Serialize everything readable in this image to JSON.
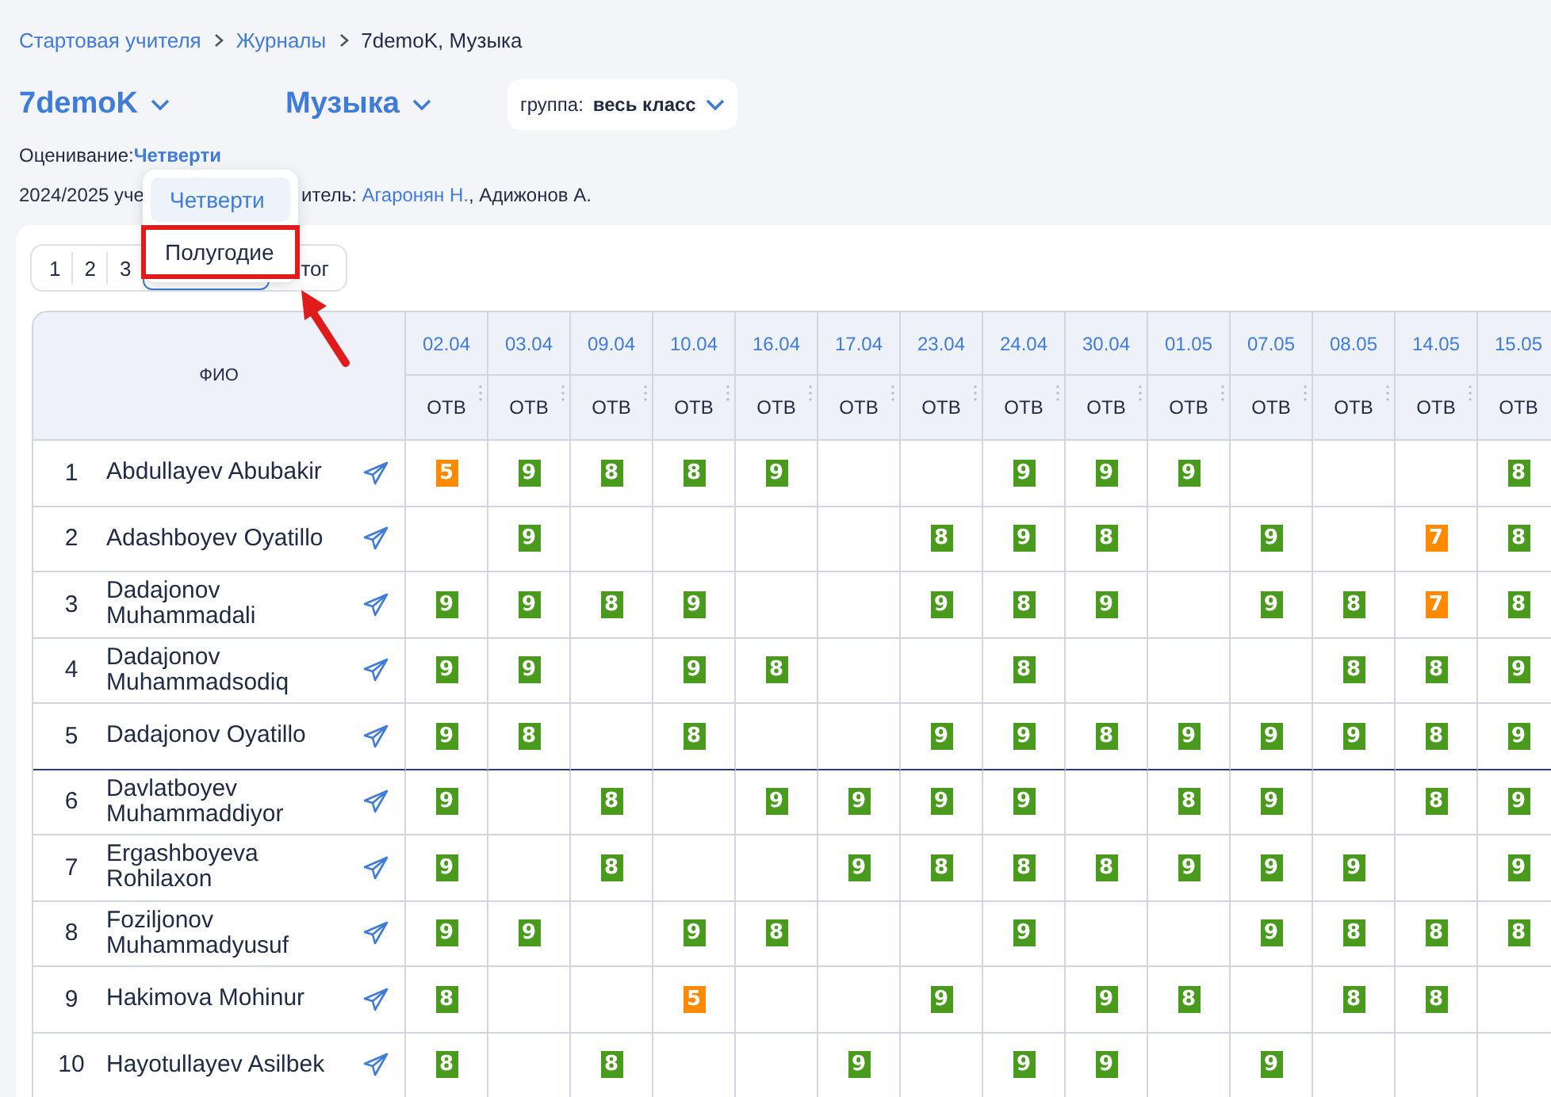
{
  "breadcrumbs": [
    {
      "label": "Стартовая учителя",
      "link": true
    },
    {
      "label": "Журналы",
      "link": true
    },
    {
      "label": "7demoK, Музыка",
      "link": false
    }
  ],
  "class_select": {
    "value": "7demoK"
  },
  "subject_select": {
    "value": "Музыка"
  },
  "group_select": {
    "label": "группа:",
    "value": "весь класс"
  },
  "grading": {
    "label": "Оценивание:",
    "value": "Четверти"
  },
  "info_line": {
    "before": "2024/2025 уче",
    "after": "итель:",
    "teacher_link": "Агаронян Н.",
    "rest": ", Адижонов А."
  },
  "grading_menu": {
    "items": [
      {
        "label": "Четверти",
        "selected": true,
        "highlighted": false
      },
      {
        "label": "Полугодие",
        "selected": false,
        "highlighted": true
      }
    ]
  },
  "period_tabs": [
    {
      "label": "1",
      "selected": false
    },
    {
      "label": "2",
      "selected": false
    },
    {
      "label": "3",
      "selected": false
    },
    {
      "selected": true
    },
    {
      "label": "тог",
      "selected": false
    }
  ],
  "table": {
    "name_header": "ФИО",
    "dates": [
      "02.04",
      "03.04",
      "09.04",
      "10.04",
      "16.04",
      "17.04",
      "23.04",
      "24.04",
      "30.04",
      "01.05",
      "07.05",
      "08.05",
      "14.05",
      "15.05"
    ],
    "types": [
      "ОТВ",
      "ОТВ",
      "ОТВ",
      "ОТВ",
      "ОТВ",
      "ОТВ",
      "ОТВ",
      "ОТВ",
      "ОТВ",
      "ОТВ",
      "ОТВ",
      "ОТВ",
      "ОТВ",
      "ОТВ"
    ],
    "rows": [
      {
        "number": "1",
        "name": "Abdullayev Abubakir",
        "cells": [
          {
            "kind": "grade",
            "mark": "5"
          },
          {
            "kind": "grade",
            "mark": "9"
          },
          {
            "kind": "grade",
            "mark": "8"
          },
          {
            "kind": "grade",
            "mark": "8"
          },
          {
            "kind": "grade",
            "mark": "9"
          },
          {
            "kind": "empty"
          },
          {
            "kind": "empty"
          },
          {
            "kind": "grade",
            "mark": "9"
          },
          {
            "kind": "grade",
            "mark": "9"
          },
          {
            "kind": "grade",
            "mark": "9"
          },
          {
            "kind": "empty"
          },
          {
            "kind": "empty"
          },
          {
            "kind": "empty"
          },
          {
            "kind": "grade",
            "mark": "8"
          }
        ]
      },
      {
        "number": "2",
        "name": "Adashboyev Oyatillo",
        "cells": [
          {
            "kind": "empty"
          },
          {
            "kind": "grade",
            "mark": "9"
          },
          {
            "kind": "empty"
          },
          {
            "kind": "empty"
          },
          {
            "kind": "empty"
          },
          {
            "kind": "empty"
          },
          {
            "kind": "grade",
            "mark": "8"
          },
          {
            "kind": "grade",
            "mark": "9"
          },
          {
            "kind": "grade",
            "mark": "8"
          },
          {
            "kind": "empty"
          },
          {
            "kind": "grade",
            "mark": "9"
          },
          {
            "kind": "empty"
          },
          {
            "kind": "grade",
            "mark": "7"
          },
          {
            "kind": "grade",
            "mark": "8"
          }
        ]
      },
      {
        "number": "3",
        "name": "Dadajonov Muhammadali",
        "cells": [
          {
            "kind": "grade",
            "mark": "9"
          },
          {
            "kind": "grade",
            "mark": "9"
          },
          {
            "kind": "grade",
            "mark": "8"
          },
          {
            "kind": "grade",
            "mark": "9"
          },
          {
            "kind": "empty"
          },
          {
            "kind": "empty"
          },
          {
            "kind": "grade",
            "mark": "9"
          },
          {
            "kind": "grade",
            "mark": "8"
          },
          {
            "kind": "grade",
            "mark": "9"
          },
          {
            "kind": "empty"
          },
          {
            "kind": "grade",
            "mark": "9"
          },
          {
            "kind": "grade",
            "mark": "8"
          },
          {
            "kind": "grade",
            "mark": "7"
          },
          {
            "kind": "grade",
            "mark": "8"
          }
        ]
      },
      {
        "number": "4",
        "name": "Dadajonov Muhammadsodiq",
        "cells": [
          {
            "kind": "grade",
            "mark": "9"
          },
          {
            "kind": "grade",
            "mark": "9"
          },
          {
            "kind": "empty"
          },
          {
            "kind": "grade",
            "mark": "9"
          },
          {
            "kind": "grade",
            "mark": "8"
          },
          {
            "kind": "empty"
          },
          {
            "kind": "empty"
          },
          {
            "kind": "grade",
            "mark": "8"
          },
          {
            "kind": "empty"
          },
          {
            "kind": "empty"
          },
          {
            "kind": "empty"
          },
          {
            "kind": "grade",
            "mark": "8"
          },
          {
            "kind": "grade",
            "mark": "8"
          },
          {
            "kind": "grade",
            "mark": "9"
          }
        ]
      },
      {
        "number": "5",
        "name": "Dadajonov Oyatillo",
        "cells": [
          {
            "kind": "grade",
            "mark": "9"
          },
          {
            "kind": "grade",
            "mark": "8"
          },
          {
            "kind": "empty"
          },
          {
            "kind": "grade",
            "mark": "8"
          },
          {
            "kind": "empty"
          },
          {
            "kind": "empty"
          },
          {
            "kind": "grade",
            "mark": "9"
          },
          {
            "kind": "grade",
            "mark": "9"
          },
          {
            "kind": "grade",
            "mark": "8"
          },
          {
            "kind": "grade",
            "mark": "9"
          },
          {
            "kind": "grade",
            "mark": "9"
          },
          {
            "kind": "grade",
            "mark": "9"
          },
          {
            "kind": "grade",
            "mark": "8"
          },
          {
            "kind": "grade",
            "mark": "9"
          }
        ]
      },
      {
        "number": "6",
        "name": "Davlatboyev Muhammaddiyor",
        "cells": [
          {
            "kind": "grade",
            "mark": "9"
          },
          {
            "kind": "empty"
          },
          {
            "kind": "grade",
            "mark": "8"
          },
          {
            "kind": "empty"
          },
          {
            "kind": "grade",
            "mark": "9"
          },
          {
            "kind": "grade",
            "mark": "9"
          },
          {
            "kind": "grade",
            "mark": "9"
          },
          {
            "kind": "grade",
            "mark": "9"
          },
          {
            "kind": "empty"
          },
          {
            "kind": "grade",
            "mark": "8"
          },
          {
            "kind": "grade",
            "mark": "9"
          },
          {
            "kind": "empty"
          },
          {
            "kind": "grade",
            "mark": "8"
          },
          {
            "kind": "grade",
            "mark": "9"
          }
        ]
      },
      {
        "number": "7",
        "name": "Ergashboyeva Rohilaxon",
        "cells": [
          {
            "kind": "grade",
            "mark": "9"
          },
          {
            "kind": "empty"
          },
          {
            "kind": "grade",
            "mark": "8"
          },
          {
            "kind": "empty"
          },
          {
            "kind": "empty"
          },
          {
            "kind": "grade",
            "mark": "9"
          },
          {
            "kind": "grade",
            "mark": "8"
          },
          {
            "kind": "grade",
            "mark": "8"
          },
          {
            "kind": "grade",
            "mark": "8"
          },
          {
            "kind": "grade",
            "mark": "9"
          },
          {
            "kind": "grade",
            "mark": "9"
          },
          {
            "kind": "grade",
            "mark": "9"
          },
          {
            "kind": "empty"
          },
          {
            "kind": "grade",
            "mark": "9"
          }
        ]
      },
      {
        "number": "8",
        "name": "Foziljonov Muhammadyusuf",
        "cells": [
          {
            "kind": "grade",
            "mark": "9"
          },
          {
            "kind": "grade",
            "mark": "9"
          },
          {
            "kind": "empty"
          },
          {
            "kind": "grade",
            "mark": "9"
          },
          {
            "kind": "grade",
            "mark": "8"
          },
          {
            "kind": "empty"
          },
          {
            "kind": "empty"
          },
          {
            "kind": "grade",
            "mark": "9"
          },
          {
            "kind": "empty"
          },
          {
            "kind": "empty"
          },
          {
            "kind": "grade",
            "mark": "9"
          },
          {
            "kind": "grade",
            "mark": "8"
          },
          {
            "kind": "grade",
            "mark": "8"
          },
          {
            "kind": "grade",
            "mark": "8"
          }
        ]
      },
      {
        "number": "9",
        "name": "Hakimova Mohinur",
        "cells": [
          {
            "kind": "grade",
            "mark": "8"
          },
          {
            "kind": "empty"
          },
          {
            "kind": "empty"
          },
          {
            "kind": "grade",
            "mark": "5"
          },
          {
            "kind": "empty"
          },
          {
            "kind": "empty"
          },
          {
            "kind": "grade",
            "mark": "9"
          },
          {
            "kind": "empty"
          },
          {
            "kind": "grade",
            "mark": "9"
          },
          {
            "kind": "grade",
            "mark": "8"
          },
          {
            "kind": "empty"
          },
          {
            "kind": "grade",
            "mark": "8"
          },
          {
            "kind": "grade",
            "mark": "8"
          },
          {
            "kind": "empty"
          }
        ]
      },
      {
        "number": "10",
        "name": "Hayotullayev Asilbek",
        "cells": [
          {
            "kind": "grade",
            "mark": "8"
          },
          {
            "kind": "empty"
          },
          {
            "kind": "grade",
            "mark": "8"
          },
          {
            "kind": "empty"
          },
          {
            "kind": "empty"
          },
          {
            "kind": "grade",
            "mark": "9"
          },
          {
            "kind": "empty"
          },
          {
            "kind": "grade",
            "mark": "9"
          },
          {
            "kind": "grade",
            "mark": "9"
          },
          {
            "kind": "empty"
          },
          {
            "kind": "grade",
            "mark": "9"
          },
          {
            "kind": "empty"
          },
          {
            "kind": "empty"
          },
          {
            "kind": "empty"
          }
        ]
      }
    ]
  }
}
